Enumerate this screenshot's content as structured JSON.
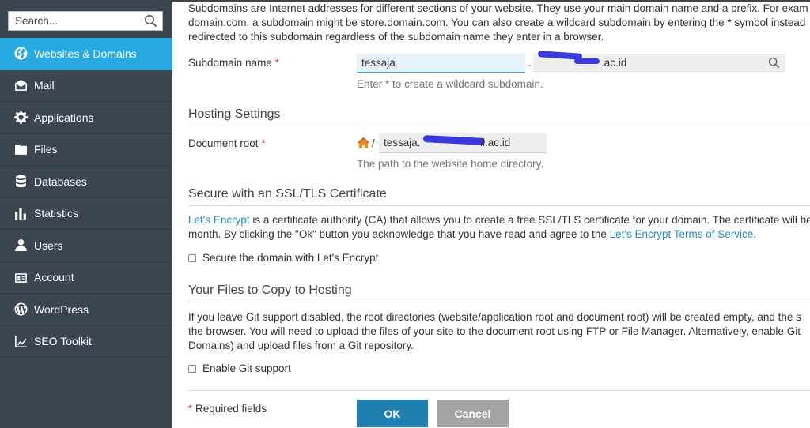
{
  "sidebar": {
    "search_placeholder": "Search...",
    "items": [
      {
        "label": "Websites & Domains",
        "icon": "globe-icon",
        "active": true
      },
      {
        "label": "Mail",
        "icon": "envelope-icon"
      },
      {
        "label": "Applications",
        "icon": "gear-icon"
      },
      {
        "label": "Files",
        "icon": "folder-icon"
      },
      {
        "label": "Databases",
        "icon": "database-icon"
      },
      {
        "label": "Statistics",
        "icon": "bar-chart-icon"
      },
      {
        "label": "Users",
        "icon": "user-icon"
      },
      {
        "label": "Account",
        "icon": "id-card-icon"
      },
      {
        "label": "WordPress",
        "icon": "wordpress-icon"
      },
      {
        "label": "SEO Toolkit",
        "icon": "seo-chart-icon"
      }
    ]
  },
  "intro": {
    "line1": "Subdomains are Internet addresses for different sections of your website. They use your main domain name and a prefix. For exam",
    "line2": "domain.com, a subdomain might be store.domain.com. You can also create a wildcard subdomain by entering the * symbol instead",
    "line3": "redirected to this subdomain regardless of the subdomain name they enter in a browser."
  },
  "subdomain": {
    "label": "Subdomain name",
    "required_mark": "*",
    "value": "tessaja",
    "separator": ".",
    "domain_visible_suffix": ".ac.id",
    "hint": "Enter * to create a wildcard subdomain."
  },
  "hosting": {
    "title": "Hosting Settings",
    "docroot_label": "Document root",
    "required_mark": "*",
    "slash": "/",
    "docroot_prefix": "tessaja.",
    "docroot_suffix": "il.ac.id",
    "hint": "The path to the website home directory."
  },
  "ssl": {
    "title": "Secure with an SSL/TLS Certificate",
    "link1": "Let's Encrypt",
    "text1": " is a certificate authority (CA) that allows you to create a free SSL/TLS certificate for your domain. The certificate will be",
    "text2": "month. By clicking the \"Ok\" button you acknowledge that you have read and agree to the ",
    "link2": "Let's Encrypt Terms of Service",
    "text2_end": ".",
    "checkbox_label": "Secure the domain with Let's Encrypt"
  },
  "files": {
    "title": "Your Files to Copy to Hosting",
    "line1": "If you leave Git support disabled, the root directories (website/application root and document root) will be created empty, and the s",
    "line2": "the browser. You will need to upload the files of your site to the document root using FTP or File Manager. Alternatively, enable Git",
    "line3": "Domains) and upload files from a Git repository.",
    "checkbox_label": "Enable Git support"
  },
  "footer": {
    "required_mark": "*",
    "required_text": " Required fields",
    "ok_label": "OK",
    "cancel_label": "Cancel"
  },
  "colors": {
    "sidebar_bg": "#3c4650",
    "active": "#28a9e1",
    "ok_button": "#1f7fb0",
    "cancel_button": "#a4a4a4",
    "link": "#1e8cc8",
    "required": "#d9342b"
  }
}
